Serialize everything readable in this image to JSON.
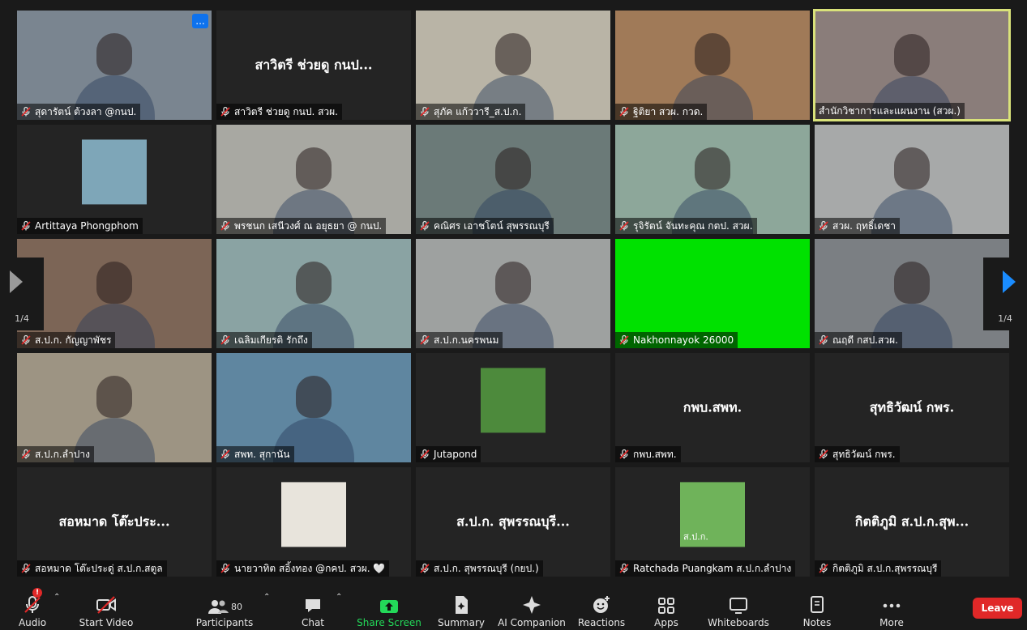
{
  "participants": [
    {
      "name": "สุดารัตน์ ต้วงลา @กนป.",
      "muted": true,
      "bg": "#7a8590"
    },
    {
      "name": "สาวิตรี ช่วยดู กนป. สวผ.",
      "muted": true,
      "display": "สาวิตรี ช่วยดู กนป..."
    },
    {
      "name": "สุภัค แก้ววารี_ส.ป.ก.",
      "muted": true,
      "bg": "#b9b4a6"
    },
    {
      "name": "ฐิติยา สวผ. กวด.",
      "muted": true,
      "bg": "#a07a58"
    },
    {
      "name": "สำนักวิชาการและแผนงาน (สวผ.)",
      "muted": false,
      "active": true,
      "bg": "#8a7d7a"
    },
    {
      "name": "Artittaya Phongphom",
      "muted": true,
      "avatar": true,
      "avatar_color": "#7ea6b8"
    },
    {
      "name": "พรชนก เสนีวงศ์ ณ อยุธยา @ กนป.",
      "muted": true,
      "bg": "#a8a8a2"
    },
    {
      "name": "คณิศร เอาชโตน์ สุพรรณบุรี",
      "muted": true,
      "bg": "#6b7a78"
    },
    {
      "name": "รุจิรัตน์ จันทะคุณ กตป. สวผ.",
      "muted": true,
      "bg": "#8da79a"
    },
    {
      "name": "สวผ. ฤทธิ์เดชา",
      "muted": true,
      "bg": "#a7a9a9"
    },
    {
      "name": "ส.ป.ก. กัญญาพัชร",
      "muted": true,
      "bg": "#7c6556"
    },
    {
      "name": "เฉลิมเกียรติ รักถึง",
      "muted": true,
      "bg": "#8aa3a3"
    },
    {
      "name": "ส.ป.ก.นครพนม",
      "muted": true,
      "bg": "#9ea1a0"
    },
    {
      "name": "Nakhonnayok 26000",
      "muted": true,
      "bg": "#00e100"
    },
    {
      "name": "ณฤดี กสป.สวผ.",
      "muted": true,
      "bg": "#7b7f83"
    },
    {
      "name": "ส.ป.ก.ลำปาง",
      "muted": true,
      "bg": "#9d9483"
    },
    {
      "name": "สพท. สุกานัน",
      "muted": true,
      "bg": "#5f86a0"
    },
    {
      "name": "Jutapond",
      "muted": true,
      "avatar": true,
      "avatar_color": "#4d8a3c"
    },
    {
      "name": "กพบ.สพท.",
      "muted": true,
      "display": "กพบ.สพท."
    },
    {
      "name": "สุทธิวัฒน์ กพร.",
      "muted": true,
      "display": "สุทธิวัฒน์ กพร."
    },
    {
      "name": "สอหมาด โต๊ะประดู่ ส.ป.ก.สตูล",
      "muted": true,
      "display": "สอหมาด โต๊ะประ..."
    },
    {
      "name": "นายวาทิต สอิ้งทอง @กคป. สวผ. 🤍",
      "muted": true,
      "avatar": true,
      "avatar_color": "#e8e4dc"
    },
    {
      "name": "ส.ป.ก. สุพรรณบุรี (กยป.)",
      "muted": true,
      "display": "ส.ป.ก. สุพรรณบุรี..."
    },
    {
      "name": "Ratchada Puangkam  ส.ป.ก.ลำปาง",
      "muted": true,
      "avatar": true,
      "avatar_color": "#6fb35a"
    },
    {
      "name": "กิตติภูมิ ส.ป.ก.สุพรรณบุรี",
      "muted": true,
      "display": "กิตติภูมิ ส.ป.ก.สุพ..."
    }
  ],
  "avatar_texts": {
    "ratchada": "ส.ป.ก."
  },
  "pagination": {
    "left": "1/4",
    "right": "1/4"
  },
  "more_options": "...",
  "toolbar": {
    "audio": "Audio",
    "start_video": "Start Video",
    "participants": "Participants",
    "participants_count": "80",
    "chat": "Chat",
    "share_screen": "Share Screen",
    "summary": "Summary",
    "ai_companion": "AI Companion",
    "reactions": "Reactions",
    "apps": "Apps",
    "whiteboards": "Whiteboards",
    "notes": "Notes",
    "more": "More",
    "leave": "Leave",
    "audio_alert": "!"
  },
  "colors": {
    "share_green": "#23d959",
    "leave_red": "#e02828",
    "active_border": "#d9e27a",
    "mute_red": "#e02828",
    "arrow_blue": "#1a8cff"
  }
}
